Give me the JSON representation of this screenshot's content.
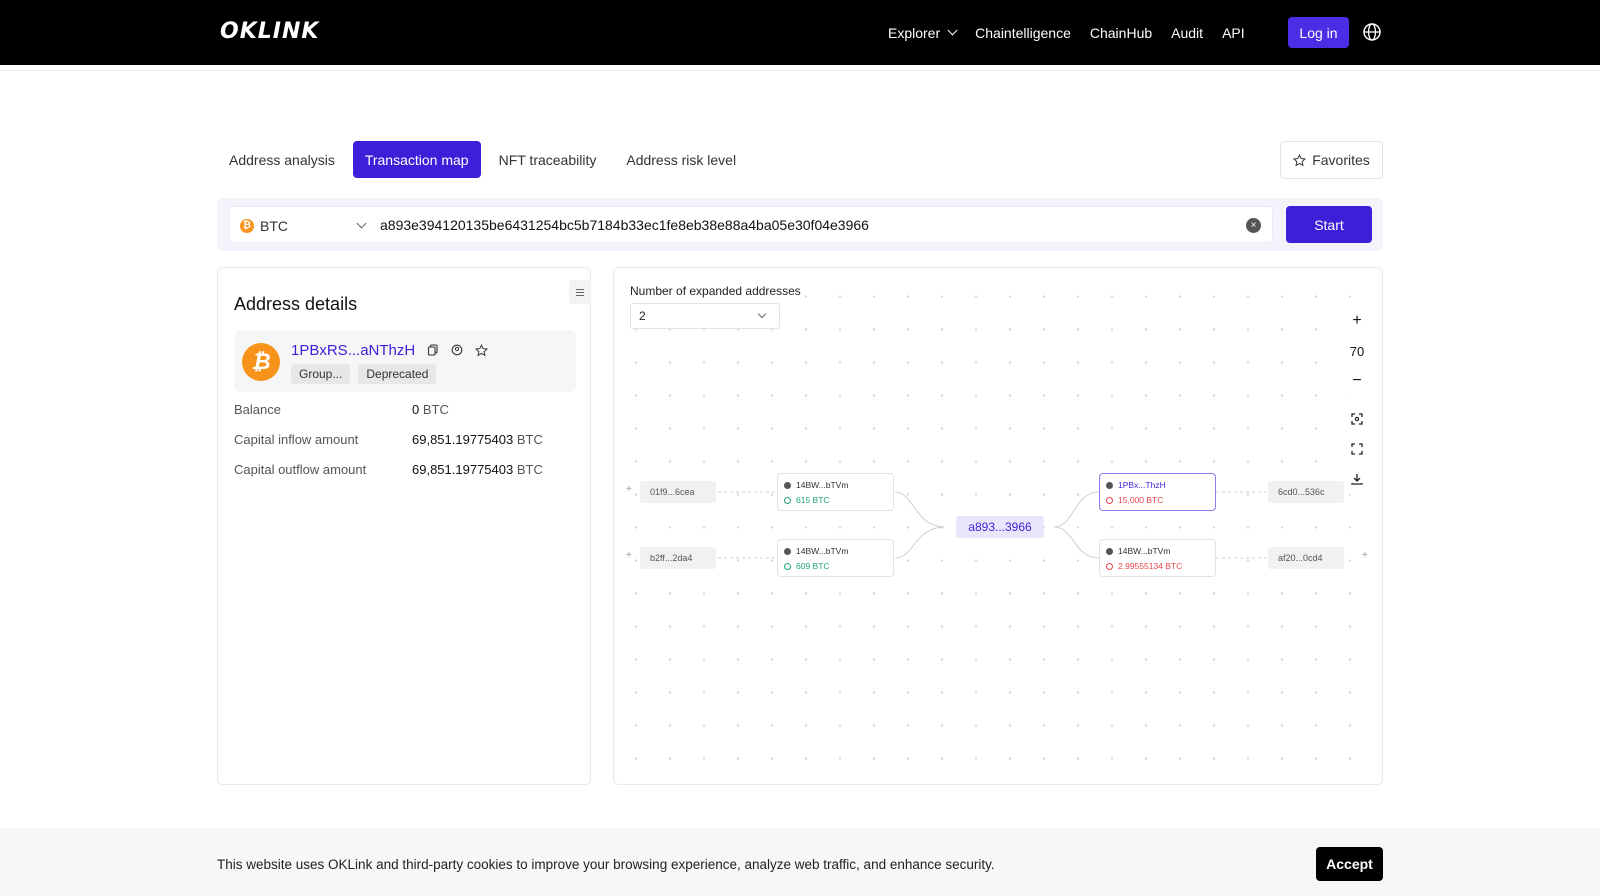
{
  "header": {
    "logo": "OKLINK",
    "nav": [
      "Explorer",
      "Chaintelligence",
      "ChainHub",
      "Audit",
      "API"
    ],
    "login_label": "Log in"
  },
  "tabs": {
    "items": [
      "Address analysis",
      "Transaction map",
      "NFT traceability",
      "Address risk level"
    ],
    "active": "Transaction map",
    "favorites_label": "Favorites"
  },
  "search": {
    "chain": "BTC",
    "value": "a893e394120135be6431254bc5b7184b33ec1fe8eb38e88a4ba05e30f04e3966",
    "start_label": "Start"
  },
  "details": {
    "title": "Address details",
    "address": "1PBxRS...aNThzH",
    "tags": [
      "Group...",
      "Deprecated"
    ],
    "balance_label": "Balance",
    "balance_value": "0",
    "inflow_label": "Capital inflow amount",
    "inflow_value": "69,851.19775403",
    "outflow_label": "Capital outflow amount",
    "outflow_value": "69,851.19775403",
    "unit": "BTC"
  },
  "map": {
    "expanded_label": "Number of expanded addresses",
    "expanded_value": "2",
    "zoom": "70",
    "inputs": [
      {
        "tx": "01f9...6cea",
        "address": "14BW...bTVm",
        "amount": "615 BTC"
      },
      {
        "tx": "b2ff...2da4",
        "address": "14BW...bTVm",
        "amount": "609 BTC"
      }
    ],
    "center": "a893...3966",
    "outputs": [
      {
        "address": "1PBx...ThzH",
        "amount": "15,000 BTC",
        "tx": "6cd0...536c"
      },
      {
        "address": "14BW...bTVm",
        "amount": "2.99555134 BTC",
        "tx": "af20...0cd4"
      }
    ]
  },
  "cookie": {
    "text": "This website uses OKLink and third-party cookies to improve your browsing experience, analyze web traffic, and enhance security.",
    "accept_label": "Accept"
  },
  "colors": {
    "accent": "#3d1fd9",
    "inflow": "#1ea672",
    "outflow": "#e6454b",
    "btc": "#f7931a"
  }
}
